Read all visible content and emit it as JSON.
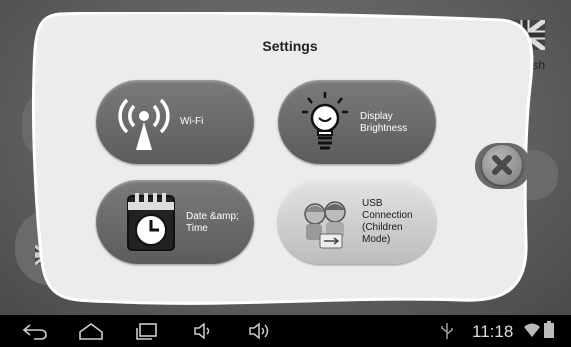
{
  "dialog": {
    "title": "Settings",
    "tiles": [
      {
        "label_lines": [
          "Wi-Fi"
        ],
        "icon": "wifi-icon"
      },
      {
        "label_lines": [
          "Display",
          "Brightness"
        ],
        "icon": "lightbulb-icon"
      },
      {
        "label_lines": [
          "Date &amp;",
          "Time"
        ],
        "icon": "calendar-clock-icon"
      },
      {
        "label_lines": [
          "USB",
          "Connection",
          "(Children",
          "Mode)"
        ],
        "icon": "children-usb-icon"
      }
    ],
    "close_icon": "close-icon"
  },
  "background": {
    "language_label": "lish",
    "flag_icon": "uk-flag-icon"
  },
  "statusbar": {
    "time": "11:18",
    "icons": [
      "back-icon",
      "home-icon",
      "recent-apps-icon",
      "volume-down-icon",
      "volume-up-icon",
      "usb-icon",
      "wifi-signal-icon",
      "battery-icon"
    ]
  },
  "colors": {
    "dark_tile": "#666666",
    "light_tile": "#d0d0d0",
    "panel": "#ececec",
    "navbar": "#000000"
  }
}
